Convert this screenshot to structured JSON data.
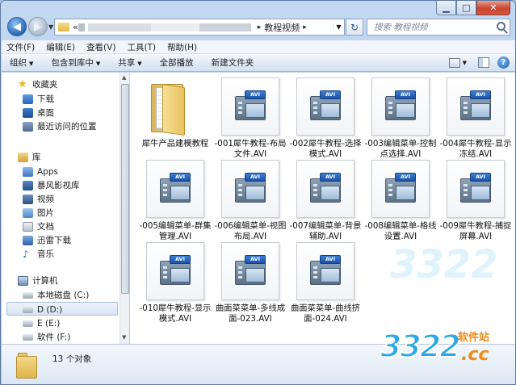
{
  "address": {
    "prefix": "«",
    "current": "教程视频"
  },
  "search": {
    "placeholder": "搜索 教程视频"
  },
  "menu": [
    "文件(F)",
    "编辑(E)",
    "查看(V)",
    "工具(T)",
    "帮助(H)"
  ],
  "toolbar": {
    "organize": "组织",
    "include": "包含到库中",
    "share": "共享",
    "play": "全部播放",
    "new_folder": "新建文件夹"
  },
  "nav": {
    "favorites": "收藏夹",
    "fav_items": [
      "下载",
      "桌面",
      "最近访问的位置"
    ],
    "libraries": "库",
    "lib_items": [
      "Apps",
      "暴风影视库",
      "视频",
      "图片",
      "文档",
      "迅雷下载",
      "音乐"
    ],
    "computer": "计算机",
    "drives": [
      "本地磁盘 (C:)",
      "D (D:)",
      "E (E:)",
      "软件 (F:)"
    ]
  },
  "files": [
    {
      "name": "犀牛产品建模教程",
      "type": "folder"
    },
    {
      "name": "-001犀牛教程-布局文件.AVI",
      "type": "avi"
    },
    {
      "name": "-002犀牛教程-选择模式.AVI",
      "type": "avi"
    },
    {
      "name": "-003编辑菜单-控制点选择.AVI",
      "type": "avi"
    },
    {
      "name": "-004犀牛教程-显示冻结.AVI",
      "type": "avi"
    },
    {
      "name": "-005编辑菜单-群集管理.AVI",
      "type": "avi"
    },
    {
      "name": "-006编辑菜单-视图布局.AVI",
      "type": "avi"
    },
    {
      "name": "-007编辑菜单-背景辅助.AVI",
      "type": "avi"
    },
    {
      "name": "-008编辑菜单-格线设置.AVI",
      "type": "avi"
    },
    {
      "name": "-009犀牛教程-捕捉屏幕.AVI",
      "type": "avi"
    },
    {
      "name": "-010犀牛教程-显示模式.AVI",
      "type": "avi"
    },
    {
      "name": "曲面菜菜单-多线成面-023.AVI",
      "type": "avi"
    },
    {
      "name": "曲面菜菜单-曲线挤面-024.AVI",
      "type": "avi"
    }
  ],
  "avi_badge": "AVI",
  "status": {
    "count": "13 个对象"
  },
  "watermark": {
    "logo": "3322",
    "site": "软件站",
    "tld": ".cc"
  },
  "icons": {
    "back": "back-arrow-icon",
    "forward": "forward-arrow-icon",
    "refresh": "refresh-icon",
    "search": "search-icon",
    "help": "help-icon"
  }
}
